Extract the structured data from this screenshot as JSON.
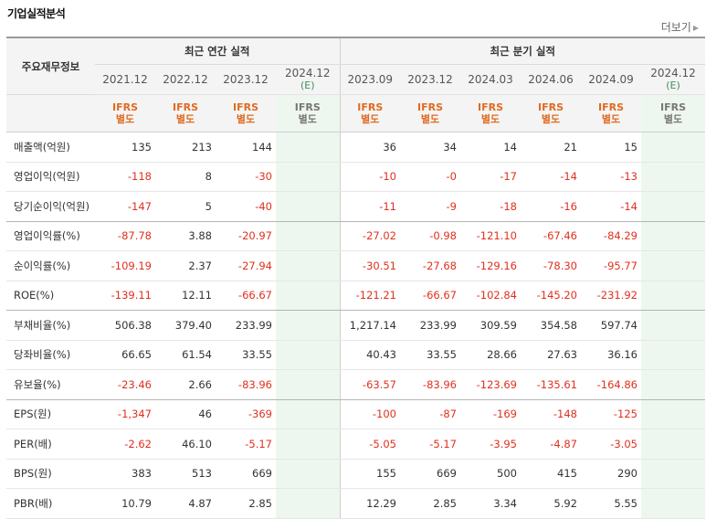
{
  "title": "기업실적분석",
  "more_label": "더보기",
  "header": {
    "row_label": "주요재무정보",
    "annual_title": "최근 연간 실적",
    "quarter_title": "최근 분기 실적",
    "annual_periods": [
      {
        "label": "2021.12",
        "estimate": false
      },
      {
        "label": "2022.12",
        "estimate": false
      },
      {
        "label": "2023.12",
        "estimate": false
      },
      {
        "label": "2024.12",
        "sub": "(E)",
        "estimate": true
      }
    ],
    "quarter_periods": [
      {
        "label": "2023.09",
        "estimate": false
      },
      {
        "label": "2023.12",
        "estimate": false
      },
      {
        "label": "2024.03",
        "estimate": false
      },
      {
        "label": "2024.06",
        "estimate": false
      },
      {
        "label": "2024.09",
        "estimate": false
      },
      {
        "label": "2024.12",
        "sub": "(E)",
        "estimate": true
      }
    ],
    "ifrs_line1": "IFRS",
    "ifrs_line2": "별도"
  },
  "rows": [
    {
      "label": "매출액(억원)",
      "annual": [
        "135",
        "213",
        "144",
        ""
      ],
      "quarter": [
        "36",
        "34",
        "14",
        "21",
        "15",
        ""
      ]
    },
    {
      "label": "영업이익(억원)",
      "annual": [
        "-118",
        "8",
        "-30",
        ""
      ],
      "quarter": [
        "-10",
        "-0",
        "-17",
        "-14",
        "-13",
        ""
      ]
    },
    {
      "label": "당기순이익(억원)",
      "annual": [
        "-147",
        "5",
        "-40",
        ""
      ],
      "quarter": [
        "-11",
        "-9",
        "-18",
        "-16",
        "-14",
        ""
      ],
      "group_end": true
    },
    {
      "label": "영업이익률(%)",
      "annual": [
        "-87.78",
        "3.88",
        "-20.97",
        ""
      ],
      "quarter": [
        "-27.02",
        "-0.98",
        "-121.10",
        "-67.46",
        "-84.29",
        ""
      ]
    },
    {
      "label": "순이익률(%)",
      "annual": [
        "-109.19",
        "2.37",
        "-27.94",
        ""
      ],
      "quarter": [
        "-30.51",
        "-27.68",
        "-129.16",
        "-78.30",
        "-95.77",
        ""
      ]
    },
    {
      "label": "ROE(%)",
      "annual": [
        "-139.11",
        "12.11",
        "-66.67",
        ""
      ],
      "quarter": [
        "-121.21",
        "-66.67",
        "-102.84",
        "-145.20",
        "-231.92",
        ""
      ],
      "group_end": true
    },
    {
      "label": "부채비율(%)",
      "annual": [
        "506.38",
        "379.40",
        "233.99",
        ""
      ],
      "quarter": [
        "1,217.14",
        "233.99",
        "309.59",
        "354.58",
        "597.74",
        ""
      ]
    },
    {
      "label": "당좌비율(%)",
      "annual": [
        "66.65",
        "61.54",
        "33.55",
        ""
      ],
      "quarter": [
        "40.43",
        "33.55",
        "28.66",
        "27.63",
        "36.16",
        ""
      ]
    },
    {
      "label": "유보율(%)",
      "annual": [
        "-23.46",
        "2.66",
        "-83.96",
        ""
      ],
      "quarter": [
        "-63.57",
        "-83.96",
        "-123.69",
        "-135.61",
        "-164.86",
        ""
      ],
      "group_end": true
    },
    {
      "label": "EPS(원)",
      "annual": [
        "-1,347",
        "46",
        "-369",
        ""
      ],
      "quarter": [
        "-100",
        "-87",
        "-169",
        "-148",
        "-125",
        ""
      ]
    },
    {
      "label": "PER(배)",
      "annual": [
        "-2.62",
        "46.10",
        "-5.17",
        ""
      ],
      "quarter": [
        "-5.05",
        "-5.17",
        "-3.95",
        "-4.87",
        "-3.05",
        ""
      ]
    },
    {
      "label": "BPS(원)",
      "annual": [
        "383",
        "513",
        "669",
        ""
      ],
      "quarter": [
        "155",
        "669",
        "500",
        "415",
        "290",
        ""
      ]
    },
    {
      "label": "PBR(배)",
      "annual": [
        "10.79",
        "4.87",
        "2.85",
        ""
      ],
      "quarter": [
        "12.29",
        "2.85",
        "3.34",
        "5.92",
        "5.55",
        ""
      ]
    }
  ]
}
